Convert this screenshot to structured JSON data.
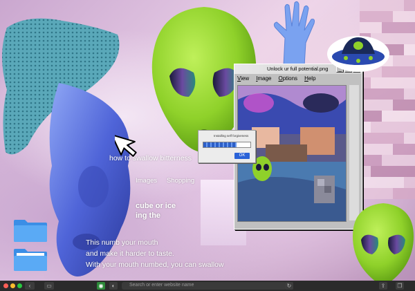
{
  "colors": {
    "alien_green": "#8fd12a",
    "statue_blue": "#5a74e0",
    "cloth_teal": "#5aa8b9",
    "window_gray": "#c0c0c0",
    "progress_blue": "#2d5fc7",
    "taskbar": "#2b2b2b"
  },
  "search": {
    "query": "how to swallow bitterness"
  },
  "nav": {
    "images": "Images",
    "shopping": "Shopping"
  },
  "article": {
    "headline_1": "cube or ice",
    "headline_2": "ing the",
    "line_1": "This      numb your mouth",
    "line_2": "and make it harder to taste.",
    "line_3": "With your mouth numbed, you can swallow"
  },
  "window": {
    "title": "Unlock ur full potential.png",
    "menu": [
      "View",
      "Image",
      "Options",
      "Help"
    ],
    "btn_min": "_",
    "btn_max": "□",
    "btn_close": "✕"
  },
  "dialog": {
    "label": "Installing self forgiveness",
    "progress": 0.7,
    "ok_label": "OK"
  },
  "taskbar": {
    "address_placeholder": "Search or enter website name",
    "traffic_lights": [
      "#ff5f57",
      "#febc2e",
      "#28c840"
    ]
  },
  "icons": {
    "cursor": "hand-pointer-icon",
    "folder": "folder-icon",
    "ufo": "ufo-sticker-icon"
  }
}
